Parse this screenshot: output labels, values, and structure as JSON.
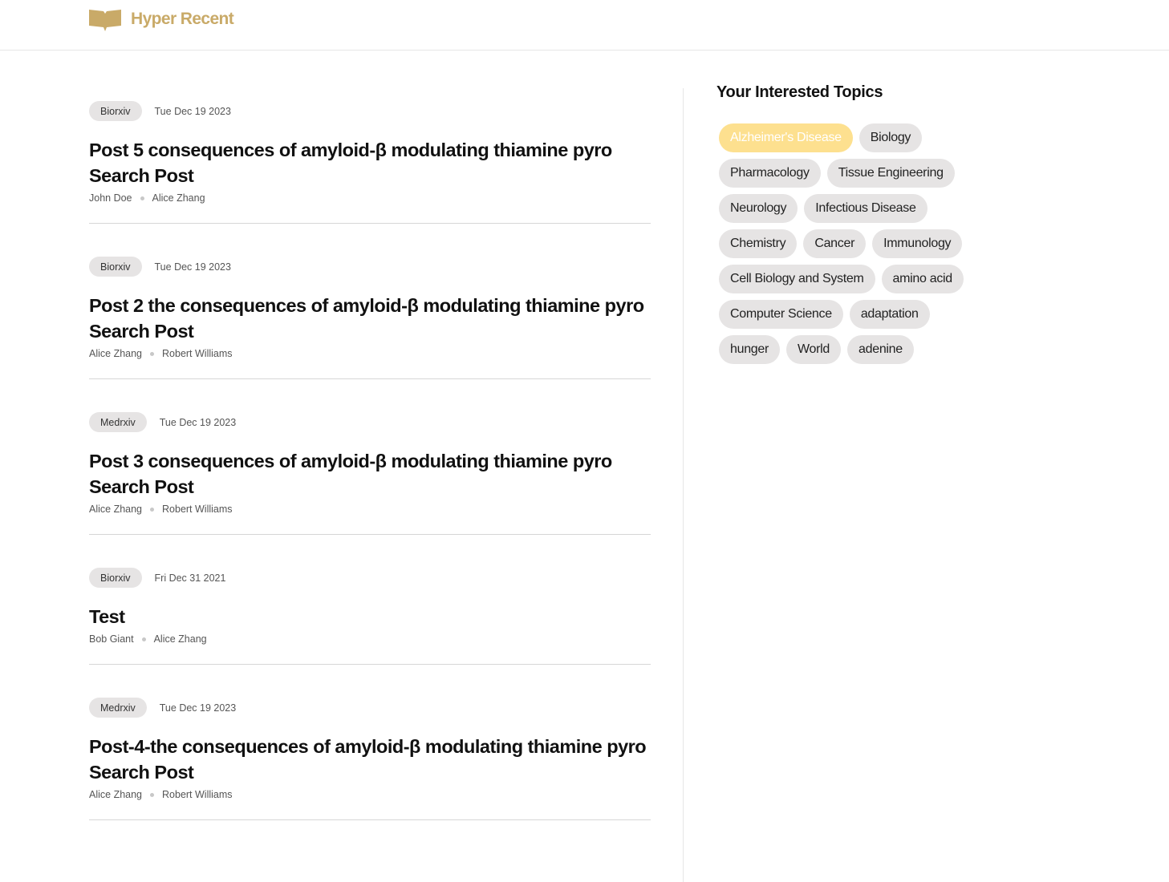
{
  "header": {
    "brand_name": "Hyper Recent",
    "brand_icon": "book-icon",
    "brand_color": "#c9aa68"
  },
  "feed": {
    "posts": [
      {
        "source": "Biorxiv",
        "date": "Tue Dec 19 2023",
        "title": "Post 5 consequences of amyloid-β modulating thiamine pyro Search Post",
        "authors": [
          "John Doe",
          "Alice Zhang"
        ]
      },
      {
        "source": "Biorxiv",
        "date": "Tue Dec 19 2023",
        "title": "Post 2 the consequences of amyloid-β modulating thiamine pyro Search Post",
        "authors": [
          "Alice Zhang",
          "Robert Williams"
        ]
      },
      {
        "source": "Medrxiv",
        "date": "Tue Dec 19 2023",
        "title": "Post 3 consequences of amyloid-β modulating thiamine pyro Search Post",
        "authors": [
          "Alice Zhang",
          "Robert Williams"
        ]
      },
      {
        "source": "Biorxiv",
        "date": "Fri Dec 31 2021",
        "title": "Test",
        "authors": [
          "Bob Giant",
          "Alice Zhang"
        ]
      },
      {
        "source": "Medrxiv",
        "date": "Tue Dec 19 2023",
        "title": "Post-4-the consequences of amyloid-β modulating thiamine pyro Search Post",
        "authors": [
          "Alice Zhang",
          "Robert Williams"
        ]
      }
    ]
  },
  "sidebar": {
    "title": "Your Interested Topics",
    "topics": [
      {
        "label": "Alzheimer's Disease",
        "active": true
      },
      {
        "label": "Biology",
        "active": false
      },
      {
        "label": "Pharmacology",
        "active": false
      },
      {
        "label": "Tissue Engineering",
        "active": false
      },
      {
        "label": "Neurology",
        "active": false
      },
      {
        "label": "Infectious Disease",
        "active": false
      },
      {
        "label": "Chemistry",
        "active": false
      },
      {
        "label": "Cancer",
        "active": false
      },
      {
        "label": "Immunology",
        "active": false
      },
      {
        "label": "Cell Biology and System",
        "active": false
      },
      {
        "label": "amino acid",
        "active": false
      },
      {
        "label": "Computer Science",
        "active": false
      },
      {
        "label": "adaptation",
        "active": false
      },
      {
        "label": "hunger",
        "active": false
      },
      {
        "label": "World",
        "active": false
      },
      {
        "label": "adenine",
        "active": false
      }
    ],
    "active_topic_color": "#fde08f",
    "topic_color": "#e6e4e4"
  }
}
